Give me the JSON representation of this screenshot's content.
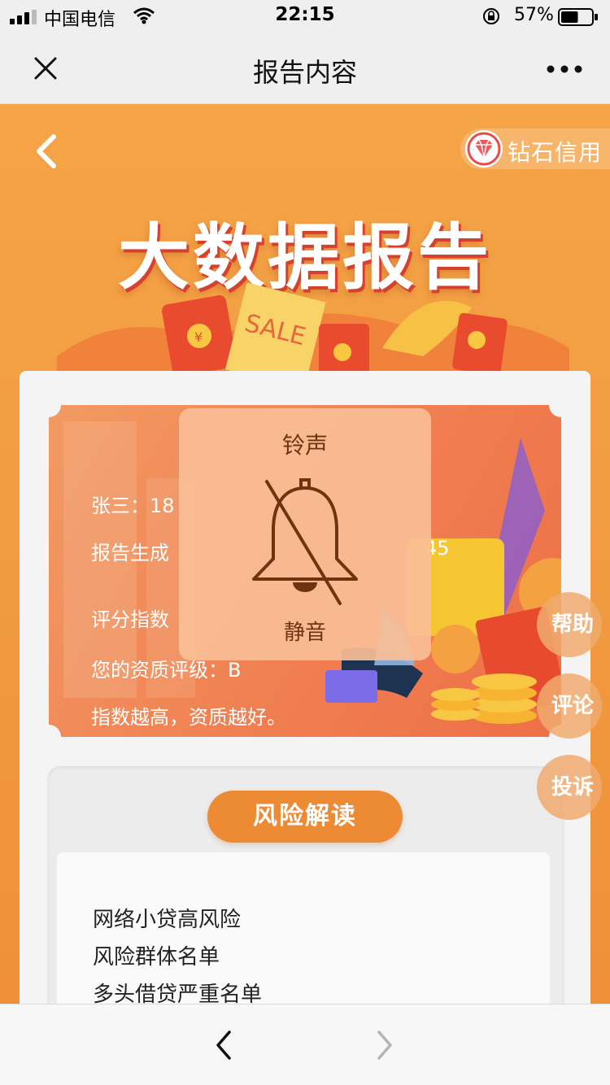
{
  "status_bar": {
    "carrier": "中国电信",
    "time": "22:15",
    "battery": "57%",
    "battery_level": 0.57
  },
  "nav": {
    "title": "报告内容"
  },
  "header": {
    "brand": "钻石信用",
    "banner_title": "大数据报告"
  },
  "deco": {
    "sale": "SALE",
    "yuan": "¥"
  },
  "info": {
    "name_line": "张三：18",
    "report_time_line": "报告生成",
    "report_time_tail": "45",
    "score_line": "评分指数",
    "grade_line": "您的资质评级：B",
    "note_line": "指数越高，资质越好。"
  },
  "risk": {
    "button": "风险解读",
    "items": [
      "网络小贷高风险",
      "风险群体名单",
      "多头借贷严重名单"
    ]
  },
  "floating": {
    "help": "帮助",
    "comment": "评论",
    "complain": "投诉"
  },
  "hud": {
    "title": "铃声",
    "subtitle": "静音"
  },
  "colors": {
    "brand_orange": "#f29d42",
    "risk_button": "#ed8a34",
    "banner_shadow": "#d6402e"
  }
}
